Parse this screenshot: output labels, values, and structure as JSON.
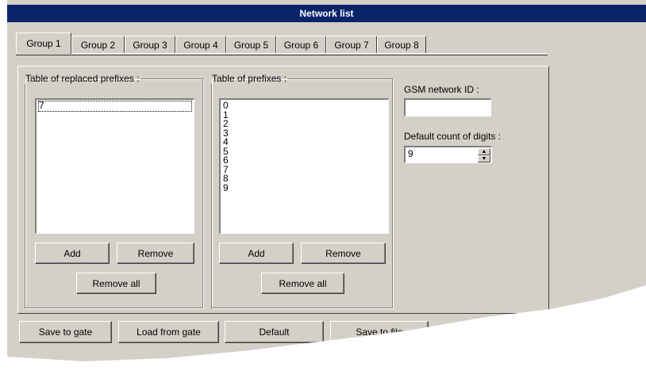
{
  "window": {
    "title": "Network list"
  },
  "tabs": [
    {
      "label": "Group 1",
      "active": true
    },
    {
      "label": "Group 2"
    },
    {
      "label": "Group 3"
    },
    {
      "label": "Group 4"
    },
    {
      "label": "Group 5"
    },
    {
      "label": "Group 6"
    },
    {
      "label": "Group 7"
    },
    {
      "label": "Group 8"
    }
  ],
  "replaced_prefixes": {
    "legend": "Table of replaced prefixes :",
    "items": [
      "7"
    ],
    "selected_index": 0,
    "add_label": "Add",
    "remove_label": "Remove",
    "remove_all_label": "Remove all"
  },
  "prefixes": {
    "legend": "Table of  prefixes :",
    "items": [
      "0",
      "1",
      "2",
      "3",
      "4",
      "5",
      "6",
      "7",
      "8",
      "9"
    ],
    "add_label": "Add",
    "remove_label": "Remove",
    "remove_all_label": "Remove all"
  },
  "gsm": {
    "network_id_label": "GSM network ID :",
    "network_id_value": "",
    "digits_label": "Default count of digits :",
    "digits_value": "9"
  },
  "footer": {
    "save_to_gate": "Save to gate",
    "load_from_gate": "Load from gate",
    "default": "Default",
    "save_to_file": "Save to file"
  }
}
